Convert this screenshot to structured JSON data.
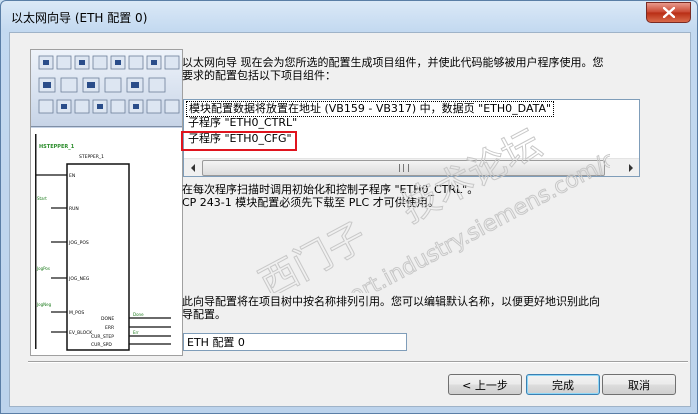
{
  "window": {
    "title": "以太网向导 (ETH 配置 0)"
  },
  "intro": {
    "line1": "以太网向导 现在会为您所选的配置生成项目组件，并使此代码能够被用户程序使用。您",
    "line2": "要求的配置包括以下项目组件："
  },
  "components": [
    {
      "label": "模块配置数据将放置在地址 (VB159 - VB317) 中，数据页 \"ETH0_DATA\""
    },
    {
      "label": "子程序 \"ETH0_CTRL\""
    },
    {
      "label": "子程序 \"ETH0_CFG\""
    }
  ],
  "info": {
    "line1": "在每次程序扫描时调用初始化和控制子程序 \"ETH0_CTRL\"。",
    "line2": "CP 243-1  模块配置必须先下载至 PLC 才可供使用。"
  },
  "naming": {
    "line1": "此向导配置将在项目树中按名称排列引用。您可以编辑默认名称，以便更好地识别此向",
    "line2": "导配置。"
  },
  "config_name": {
    "value": "ETH 配置 0"
  },
  "buttons": {
    "back": "< 上一步",
    "finish": "完成",
    "cancel": "取消"
  },
  "illustration": {
    "labels": [
      "STEPPER_1",
      "EN",
      "RUN",
      "JOG_POS",
      "JOG_NEG",
      "M_POS",
      "EV_BLOCK",
      "DONE",
      "ERR",
      "CUR_STEP",
      "CUR_STEP",
      "CUR_SPD"
    ]
  },
  "colors": {
    "highlight": "#e0141e",
    "window_frame": "#c3d9f0",
    "close_button": "#c8452f"
  }
}
